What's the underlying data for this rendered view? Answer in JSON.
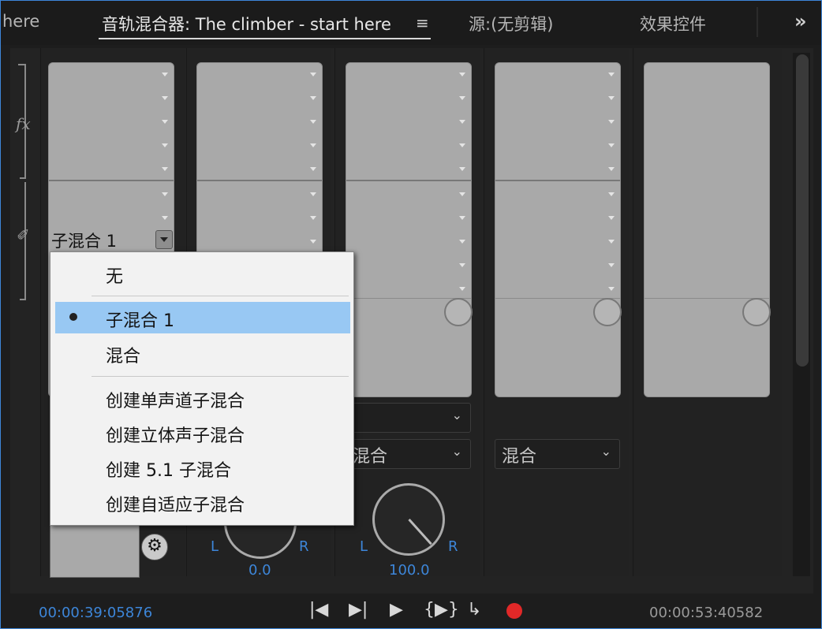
{
  "tabs": [
    {
      "label": "here"
    },
    {
      "label": "音轨混合器: The climber - start here"
    },
    {
      "label": "源:(无剪辑)"
    },
    {
      "label": "效果控件"
    }
  ],
  "icons": {
    "fx": "fx",
    "more": "»",
    "menu": "≡"
  },
  "channel_strip": {
    "submix_label": "子混合 1",
    "output_dropdowns": [
      {
        "value": "混合"
      },
      {
        "value": "混合"
      }
    ],
    "pan": [
      {
        "left": "L",
        "right": "R",
        "value": "0.0"
      },
      {
        "left": "L",
        "right": "R",
        "value": "100.0"
      }
    ]
  },
  "context_menu": {
    "items": [
      {
        "label": "无"
      },
      {
        "label": "子混合 1",
        "selected": true
      },
      {
        "label": "混合"
      },
      {
        "label": "创建单声道子混合"
      },
      {
        "label": "创建立体声子混合"
      },
      {
        "label": "创建 5.1 子混合"
      },
      {
        "label": "创建自适应子混合"
      }
    ]
  },
  "transport": {
    "timecode_in": "00:00:39:05876",
    "timecode_out": "00:00:53:40582",
    "buttons": [
      "go-to-in",
      "go-to-out",
      "play",
      "play-in-to-out",
      "loop",
      "record"
    ]
  },
  "colors": {
    "accent": "#3d86d9",
    "record": "#e12828",
    "selection": "#98c8f3"
  }
}
